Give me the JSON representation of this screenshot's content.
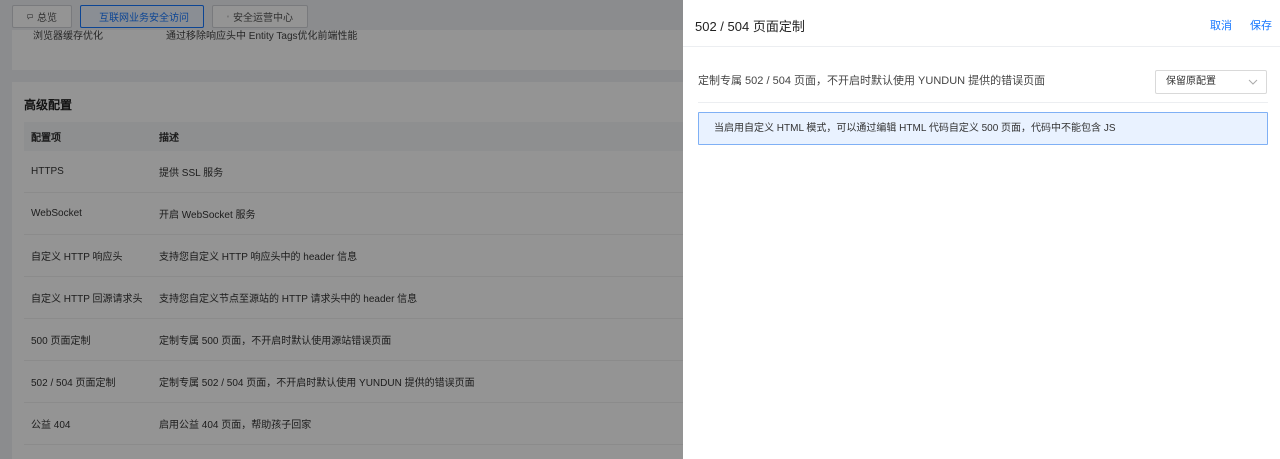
{
  "tabs": [
    {
      "label": "总览",
      "icon": "chat-icon"
    },
    {
      "label": "互联网业务安全访问",
      "icon": "link-icon"
    },
    {
      "label": "安全运营中心",
      "icon": "shield-icon"
    }
  ],
  "top_card": {
    "row_name": "浏览器缓存优化",
    "row_desc": "通过移除响应头中 Entity Tags优化前端性能"
  },
  "advanced": {
    "title": "高级配置",
    "columns": [
      "配置项",
      "描述"
    ],
    "rows": [
      {
        "name": "HTTPS",
        "desc": "提供 SSL 服务"
      },
      {
        "name": "WebSocket",
        "desc": "开启 WebSocket 服务"
      },
      {
        "name": "自定义 HTTP 响应头",
        "desc": "支持您自定义 HTTP 响应头中的 header 信息"
      },
      {
        "name": "自定义 HTTP 回源请求头",
        "desc": "支持您自定义节点至源站的 HTTP 请求头中的 header 信息"
      },
      {
        "name": "500 页面定制",
        "desc": "定制专属 500 页面，不开启时默认使用源站错误页面"
      },
      {
        "name": "502 / 504 页面定制",
        "desc": "定制专属 502 / 504 页面，不开启时默认使用 YUNDUN 提供的错误页面"
      },
      {
        "name": "公益 404",
        "desc": "启用公益 404 页面，帮助孩子回家"
      }
    ]
  },
  "drawer": {
    "title": "502 / 504 页面定制",
    "cancel_label": "取消",
    "save_label": "保存",
    "description": "定制专属 502 / 504 页面，不开启时默认使用 YUNDUN 提供的错误页面",
    "select_value": "保留原配置",
    "notice": "当启用自定义 HTML 模式，可以通过编辑 HTML 代码自定义 500 页面，代码中不能包含 JS"
  },
  "colors": {
    "accent": "#1677ff",
    "notice_bg": "#e9f2ff",
    "notice_border": "#7fb0f5"
  }
}
